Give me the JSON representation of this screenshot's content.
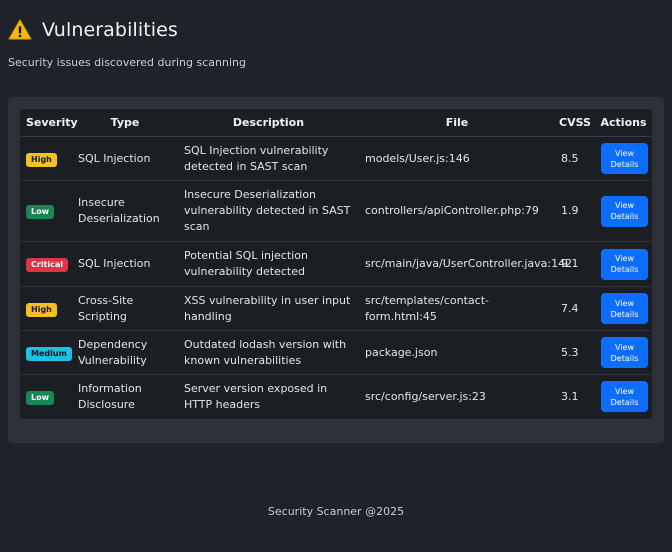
{
  "header": {
    "icon": "warning-icon",
    "title": "Vulnerabilities",
    "subtitle": "Security issues discovered during scanning"
  },
  "table": {
    "columns": [
      "Severity",
      "Type",
      "Description",
      "File",
      "CVSS",
      "Actions"
    ],
    "rows": [
      {
        "severity": "High",
        "severity_level": "high",
        "type": "SQL Injection",
        "description": "SQL Injection vulnerability detected in SAST scan",
        "file": "models/User.js:146",
        "cvss": "8.5",
        "action": "View Details"
      },
      {
        "severity": "Low",
        "severity_level": "low",
        "type": "Insecure Deserialization",
        "description": "Insecure Deserialization vulnerability detected in SAST scan",
        "file": "controllers/apiController.php:79",
        "cvss": "1.9",
        "action": "View Details"
      },
      {
        "severity": "Critical",
        "severity_level": "critical",
        "type": "SQL Injection",
        "description": "Potential SQL injection vulnerability detected",
        "file": "src/main/java/UserController.java:142",
        "cvss": "9.1",
        "action": "View Details"
      },
      {
        "severity": "High",
        "severity_level": "high",
        "type": "Cross-Site Scripting",
        "description": "XSS vulnerability in user input handling",
        "file": "src/templates/contact-form.html:45",
        "cvss": "7.4",
        "action": "View Details"
      },
      {
        "severity": "Medium",
        "severity_level": "medium",
        "type": "Dependency Vulnerability",
        "description": "Outdated lodash version with known vulnerabilities",
        "file": "package.json",
        "cvss": "5.3",
        "action": "View Details"
      },
      {
        "severity": "Low",
        "severity_level": "low",
        "type": "Information Disclosure",
        "description": "Server version exposed in HTTP headers",
        "file": "src/config/server.js:23",
        "cvss": "3.1",
        "action": "View Details"
      }
    ]
  },
  "footer": {
    "text": "Security Scanner @2025"
  },
  "colors": {
    "background": "#1f2329",
    "panel": "#2e3238",
    "table": "#1b1e23",
    "primary": "#0d6efd",
    "high": "#f5c022",
    "low": "#198754",
    "critical": "#dc3545",
    "medium": "#1fc0e6"
  }
}
